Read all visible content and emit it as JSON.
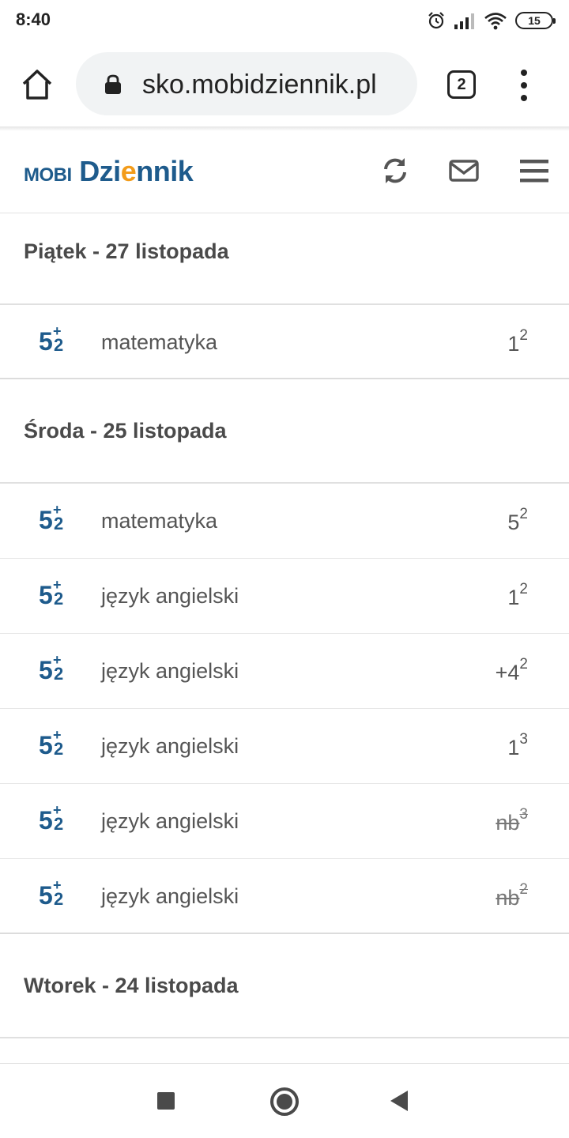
{
  "status_bar": {
    "time": "8:40",
    "battery": "15"
  },
  "browser": {
    "url": "sko.mobidziennik.pl",
    "tab_count": "2"
  },
  "app": {
    "logo_mobi": "mobi",
    "logo_dzi": "Dzi",
    "logo_e": "e",
    "logo_nnik": "nnik",
    "brand_color": "#1e5b8c",
    "accent_color": "#f39c1a"
  },
  "days": [
    {
      "label": "Piątek  -  27 listopada",
      "grades": [
        {
          "subject": "matematyka",
          "value": "1",
          "weight": "2",
          "struck": false
        }
      ]
    },
    {
      "label": "Środa  -  25 listopada",
      "grades": [
        {
          "subject": "matematyka",
          "value": "5",
          "weight": "2",
          "struck": false
        },
        {
          "subject": "język angielski",
          "value": "1",
          "weight": "2",
          "struck": false
        },
        {
          "subject": "język angielski",
          "value": "+4",
          "weight": "2",
          "struck": false
        },
        {
          "subject": "język angielski",
          "value": "1",
          "weight": "3",
          "struck": false
        },
        {
          "subject": "język angielski",
          "value": "nb",
          "weight": "3",
          "struck": true
        },
        {
          "subject": "język angielski",
          "value": "nb",
          "weight": "2",
          "struck": true
        }
      ]
    },
    {
      "label": "Wtorek  -  24 listopada",
      "grades": []
    }
  ],
  "grade_icon": {
    "big": "5",
    "plus": "+",
    "small": "2"
  }
}
